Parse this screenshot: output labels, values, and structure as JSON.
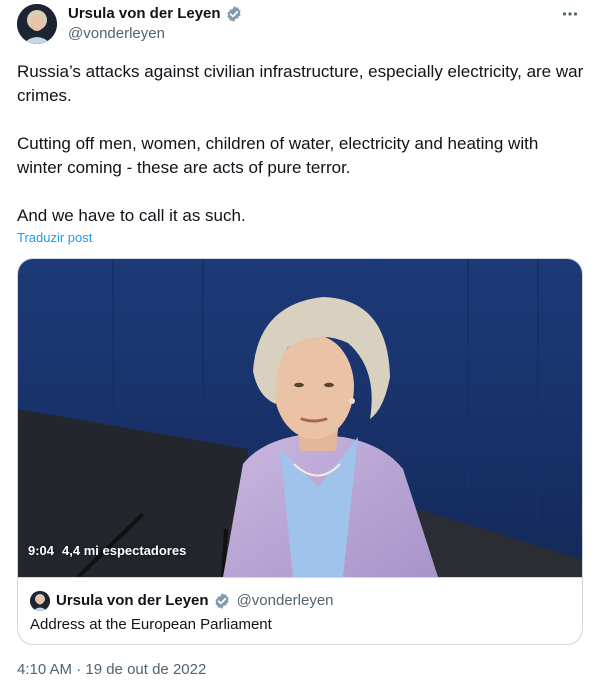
{
  "author": {
    "name": "Ursula von der Leyen",
    "handle": "@vonderleyen"
  },
  "tweet": {
    "paragraphs": [
      "Russia’s attacks against civilian infrastructure, especially electricity, are war crimes.",
      "Cutting off men, women, children of water, electricity and heating with winter coming - these are acts of pure terror.",
      "And we have to call it as such."
    ],
    "translate_label": "Traduzir post"
  },
  "media": {
    "duration": "9:04",
    "views": "4,4 mi espectadores"
  },
  "quote": {
    "name": "Ursula von der Leyen",
    "handle": "@vonderleyen",
    "caption": "Address at the European Parliament"
  },
  "timestamp": "4:10 AM · 19 de out de 2022",
  "icons": {
    "verified": "verified-badge-icon",
    "more": "more-options-icon"
  },
  "colors": {
    "link": "#1d9bf0",
    "secondary_text": "#536471",
    "verified_badge": "#829aab"
  }
}
